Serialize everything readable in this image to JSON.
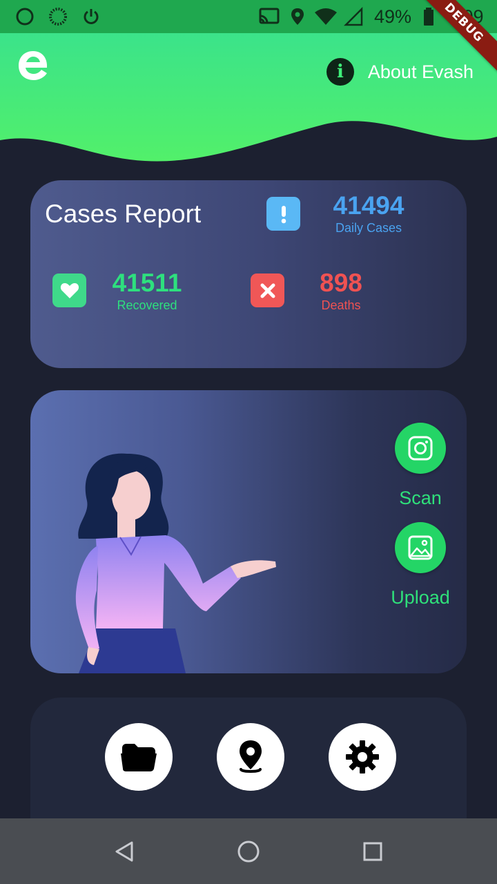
{
  "status_bar": {
    "battery": "49%",
    "time": "6:09",
    "icons": [
      "circle-icon",
      "dotted-circle-icon",
      "power-icon",
      "cast-icon",
      "location-icon",
      "wifi-icon",
      "signal-icon",
      "battery-icon"
    ]
  },
  "debug_banner": "DEBUG",
  "header": {
    "logo_icon": "evash-logo-icon",
    "about_label": "About Evash",
    "info_icon_glyph": "i",
    "colors": {
      "wave_top": "#3be38a",
      "wave_bottom": "#4ef06a"
    }
  },
  "report": {
    "title": "Cases Report",
    "daily": {
      "value": "41494",
      "label": "Daily Cases",
      "color": "#4aa3f0",
      "icon": "exclamation-icon"
    },
    "recovered": {
      "value": "41511",
      "label": "Recovered",
      "color": "#2ee07e",
      "icon": "heart-icon"
    },
    "deaths": {
      "value": "898",
      "label": "Deaths",
      "color": "#f05252",
      "icon": "close-icon"
    }
  },
  "actions": {
    "scan_label": "Scan",
    "upload_label": "Upload"
  },
  "bottom_nav": [
    "folder-icon",
    "map-pin-icon",
    "gear-icon"
  ],
  "system_nav": [
    "back-icon",
    "home-icon",
    "recents-icon"
  ]
}
